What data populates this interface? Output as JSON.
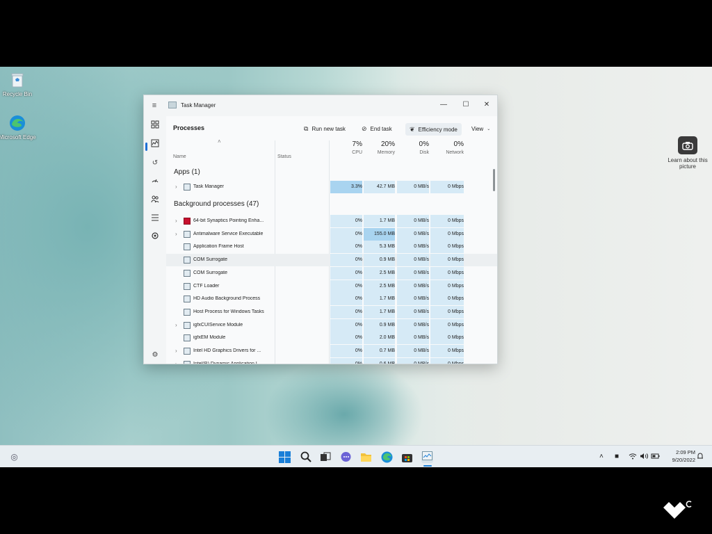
{
  "desktop": {
    "icons": [
      {
        "label": "Recycle Bin",
        "icon": "recycle-bin-icon"
      },
      {
        "label": "Microsoft Edge",
        "icon": "edge-icon"
      }
    ],
    "widget": {
      "label": "Learn about this picture",
      "icon": "camera-icon"
    }
  },
  "window": {
    "title": "Task Manager",
    "controls": {
      "minimize": "—",
      "maximize": "☐",
      "close": "✕"
    },
    "nav": [
      "processes-icon",
      "performance-icon",
      "app-history-icon",
      "startup-apps-icon",
      "users-icon",
      "details-icon",
      "services-icon",
      "settings-icon"
    ],
    "toolbar": {
      "page_title": "Processes",
      "run_new_task": "Run new task",
      "end_task": "End task",
      "efficiency_mode": "Efficiency mode",
      "view": "View"
    },
    "columns": {
      "name": "Name",
      "status": "Status",
      "cpu": {
        "pct": "7%",
        "label": "CPU"
      },
      "memory": {
        "pct": "20%",
        "label": "Memory"
      },
      "disk": {
        "pct": "0%",
        "label": "Disk"
      },
      "network": {
        "pct": "0%",
        "label": "Network"
      }
    },
    "apps_section": "Apps (1)",
    "apps": [
      {
        "name": "Task Manager",
        "cpu": "3.3%",
        "memory": "42.7 MB",
        "disk": "0 MB/s",
        "network": "0 Mbps",
        "expandable": true
      }
    ],
    "bg_section": "Background processes (47)",
    "background": [
      {
        "name": "64-bit Synaptics Pointing Enha...",
        "cpu": "0%",
        "memory": "1.7 MB",
        "disk": "0 MB/s",
        "network": "0 Mbps",
        "expandable": true
      },
      {
        "name": "Antimalware Service Executable",
        "cpu": "0%",
        "memory": "155.0 MB",
        "disk": "0 MB/s",
        "network": "0 Mbps",
        "expandable": true
      },
      {
        "name": "Application Frame Host",
        "cpu": "0%",
        "memory": "5.3 MB",
        "disk": "0 MB/s",
        "network": "0 Mbps",
        "expandable": false
      },
      {
        "name": "COM Surrogate",
        "cpu": "0%",
        "memory": "0.9 MB",
        "disk": "0 MB/s",
        "network": "0 Mbps",
        "expandable": false
      },
      {
        "name": "COM Surrogate",
        "cpu": "0%",
        "memory": "2.5 MB",
        "disk": "0 MB/s",
        "network": "0 Mbps",
        "expandable": false
      },
      {
        "name": "CTF Loader",
        "cpu": "0%",
        "memory": "2.5 MB",
        "disk": "0 MB/s",
        "network": "0 Mbps",
        "expandable": false
      },
      {
        "name": "HD Audio Background Process",
        "cpu": "0%",
        "memory": "1.7 MB",
        "disk": "0 MB/s",
        "network": "0 Mbps",
        "expandable": false
      },
      {
        "name": "Host Process for Windows Tasks",
        "cpu": "0%",
        "memory": "1.7 MB",
        "disk": "0 MB/s",
        "network": "0 Mbps",
        "expandable": false
      },
      {
        "name": "igfxCUIService Module",
        "cpu": "0%",
        "memory": "0.9 MB",
        "disk": "0 MB/s",
        "network": "0 Mbps",
        "expandable": true
      },
      {
        "name": "igfxEM Module",
        "cpu": "0%",
        "memory": "2.0 MB",
        "disk": "0 MB/s",
        "network": "0 Mbps",
        "expandable": false
      },
      {
        "name": "Intel HD Graphics Drivers for ...",
        "cpu": "0%",
        "memory": "0.7 MB",
        "disk": "0 MB/s",
        "network": "0 Mbps",
        "expandable": true
      },
      {
        "name": "Intel(R) Dynamic Application L...",
        "cpu": "0%",
        "memory": "0.6 MB",
        "disk": "0 MB/s",
        "network": "0 Mbps",
        "expandable": true
      }
    ]
  },
  "taskbar": {
    "apps": [
      "start-icon",
      "search-icon",
      "task-view-icon",
      "chat-icon",
      "file-explorer-icon",
      "edge-icon",
      "store-icon",
      "task-manager-icon"
    ],
    "clock_time": "2:09 PM",
    "clock_date": "9/20/2022"
  },
  "colors": {
    "accent": "#1d6fd6",
    "heat_light": "#d6eaf6",
    "heat_strong": "#a9d4f0"
  }
}
